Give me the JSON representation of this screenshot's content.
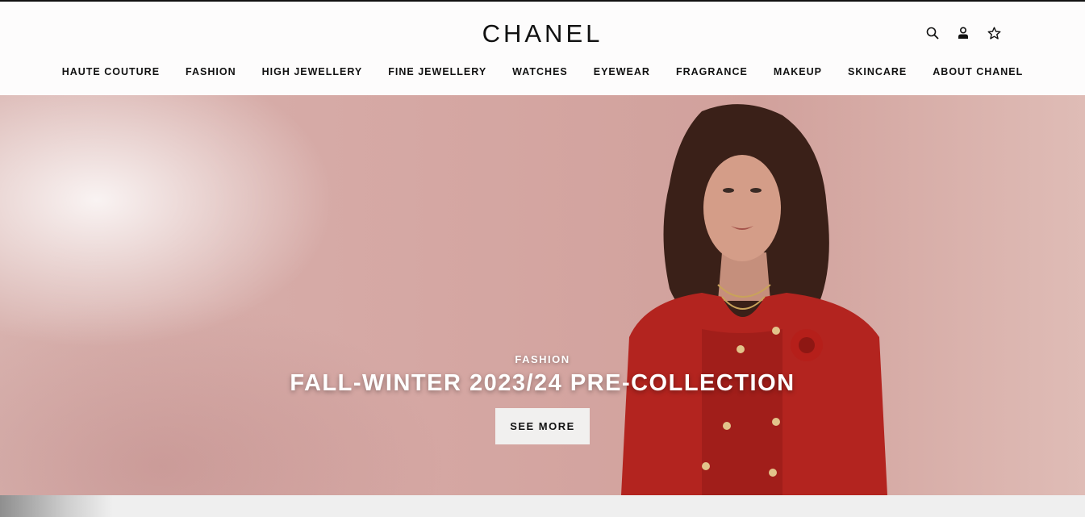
{
  "header": {
    "logo": "CHANEL",
    "icons": [
      "search-icon",
      "account-icon",
      "wishlist-star-icon"
    ]
  },
  "nav": {
    "items": [
      {
        "label": "HAUTE COUTURE"
      },
      {
        "label": "FASHION"
      },
      {
        "label": "HIGH JEWELLERY"
      },
      {
        "label": "FINE JEWELLERY"
      },
      {
        "label": "WATCHES"
      },
      {
        "label": "EYEWEAR"
      },
      {
        "label": "FRAGRANCE"
      },
      {
        "label": "MAKEUP"
      },
      {
        "label": "SKINCARE"
      },
      {
        "label": "ABOUT CHANEL"
      }
    ]
  },
  "hero": {
    "kicker": "FASHION",
    "title": "FALL-WINTER 2023/24 PRE-COLLECTION",
    "button_label": "SEE MORE"
  },
  "colors": {
    "text": "#111111",
    "hero_background": "#d5a7a3",
    "jacket_red": "#b3241f",
    "button_bg": "#f1f0ef"
  }
}
